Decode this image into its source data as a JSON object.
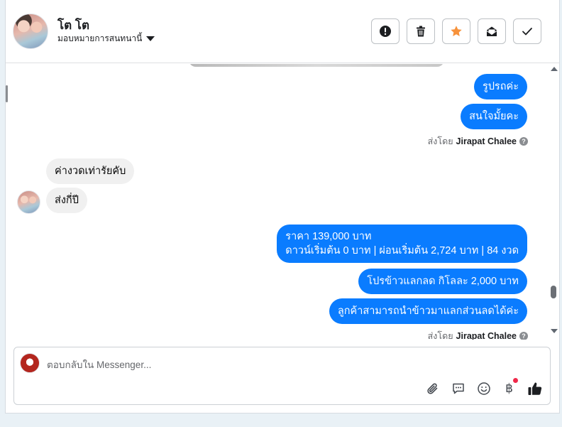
{
  "header": {
    "contact_name": "โต โต",
    "assign_label": "มอบหมายการสนทนานี้"
  },
  "actions": [
    {
      "name": "spam-report",
      "icon": "exclamation-circle-icon"
    },
    {
      "name": "delete",
      "icon": "trash-icon"
    },
    {
      "name": "star",
      "icon": "star-icon",
      "color": "#f7923b"
    },
    {
      "name": "mark-unread",
      "icon": "envelope-open-icon"
    },
    {
      "name": "mark-done",
      "icon": "check-icon"
    }
  ],
  "messages": {
    "out_1": "รูปรถค่ะ",
    "out_2": "สนใจมั้ยคะ",
    "sent_by_1": {
      "prefix": "ส่งโดย",
      "name": "Jirapat Chalee"
    },
    "in_1": "ค่างวดเท่ารัยคับ",
    "in_2": "ส่งกี่ปี",
    "out_3_line1": "ราคา 139,000 บาท",
    "out_3_line2": "ดาวน์เริ่มต้น 0 บาท | ผ่อนเริ่มต้น 2,724 บาท | 84 งวด",
    "out_4": "โปรข้าวแลกลด กิโลละ 2,000 บาท",
    "out_5": "ลูกค้าสามารถนำข้าวมาแลกส่วนลดได้ค่ะ",
    "sent_by_2": {
      "prefix": "ส่งโดย",
      "name": "Jirapat Chalee"
    }
  },
  "composer": {
    "placeholder": "ตอบกลับใน Messenger...",
    "tools": [
      "paperclip-icon",
      "chat-bubble-icon",
      "smiley-icon",
      "baht-icon",
      "thumbs-up-icon"
    ],
    "baht_symbol": "฿"
  },
  "colors": {
    "outgoing_bubble": "#0a7cff",
    "incoming_bubble": "#f0f0f0",
    "star": "#f7923b",
    "notification_dot": "#f0284a"
  }
}
